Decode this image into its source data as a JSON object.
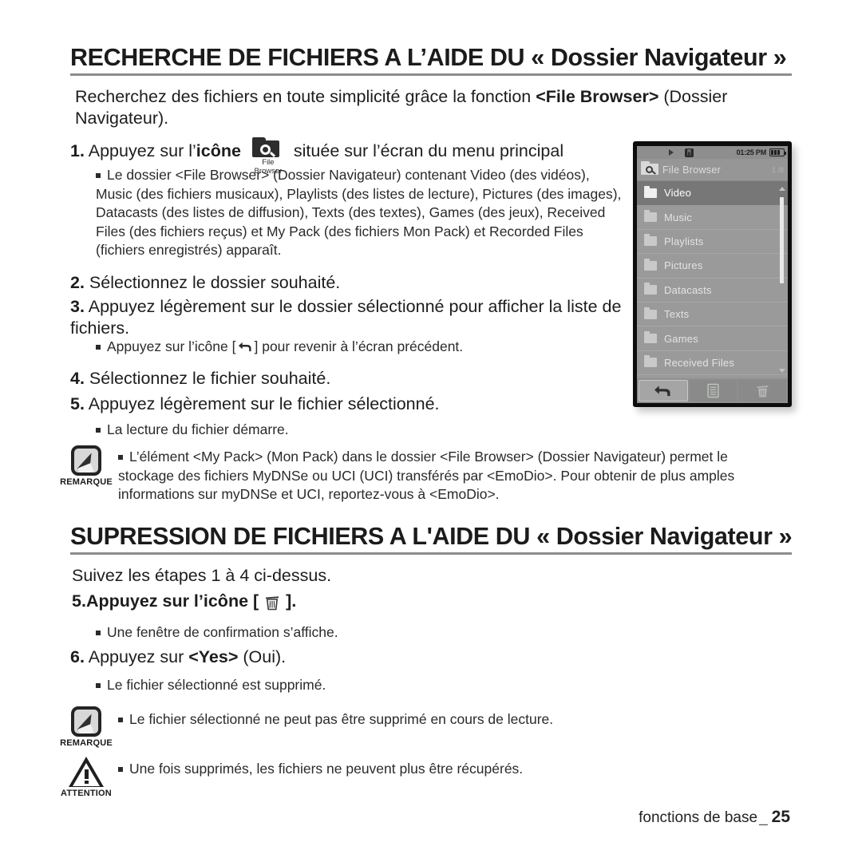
{
  "document": {
    "headings": {
      "search": "RECHERCHE DE FICHIERS A L’AIDE DU « Dossier Navigateur »",
      "delete": "SUPRESSION DE FICHIERS A L'AIDE DU « Dossier Navigateur »"
    },
    "intro": {
      "part1": "Recherchez des fichiers en toute simplicité grâce la fonction ",
      "bold": "<File Browser>",
      "part2": " (Dossier Navigateur)."
    },
    "steps": {
      "s1_num": "1.",
      "s1_before": "Appuyez sur l’",
      "s1_bold": "icône",
      "s1_after": "située sur l’écran du menu principal",
      "s1_icon_label": "File Browser",
      "s1_bullet": "Le dossier <File Browser> (Dossier Navigateur) contenant Video (des vidéos), Music (des fichiers musicaux), Playlists (des listes de lecture), Pictures (des images), Datacasts (des listes de diffusion), Texts (des textes), Games (des jeux), Received Files (des fichiers reçus) et My Pack (des fichiers Mon Pack) et Recorded Files (fichiers enregistrés) apparaît.",
      "s2_num": "2.",
      "s2_text": "Sélectionnez le dossier souhaité.",
      "s3_num": "3.",
      "s3_text": "Appuyez légèrement sur le dossier sélectionné pour afficher la liste de fichiers.",
      "s3_bullet_before": "Appuyez sur l’icône [",
      "s3_bullet_after": "] pour revenir à l’écran précédent.",
      "s4_num": "4.",
      "s4_text": "Sélectionnez le fichier souhaité.",
      "s5_num": "5.",
      "s5_text": "Appuyez légèrement sur le fichier sélectionné.",
      "s5_bullet": "La lecture du fichier démarre."
    },
    "note_1": {
      "label": "REMARQUE",
      "text": "L’élément <My Pack> (Mon Pack) dans le dossier <File Browser> (Dossier Navigateur) permet le stockage des fichiers MyDNSe ou UCI (UCI) transférés par <EmoDio>. Pour obtenir de plus amples informations sur myDNSe et UCI, reportez-vous à <EmoDio>."
    },
    "delete_section": {
      "lead": "Suivez les étapes 1 à 4 ci-dessus.",
      "d5_num": "5.",
      "d5_before": "Appuyez sur l’icône [",
      "d5_after": "].",
      "d5_bullet": "Une fenêtre de confirmation s’affiche.",
      "d6_num": "6.",
      "d6_before": "Appuyez sur ",
      "d6_bold": "<Yes>",
      "d6_after": " (Oui).",
      "d6_bullet": "Le fichier sélectionné est supprimé."
    },
    "note_2": {
      "label": "REMARQUE",
      "text": "Le fichier sélectionné ne peut pas être supprimé en cours de lecture."
    },
    "note_3": {
      "label": "ATTENTION",
      "text": "Une fois supprimés, les fichiers ne peuvent plus être récupérés."
    },
    "footer": {
      "text": "fonctions de base",
      "dash": "_",
      "page": "25"
    }
  },
  "device": {
    "statusbar": {
      "time": "01:25 PM",
      "bluetooth_glyph": "ᛗ"
    },
    "titlebar": {
      "title": "File Browser",
      "count": "1 /8"
    },
    "list": [
      {
        "label": "Video",
        "selected": true
      },
      {
        "label": "Music",
        "selected": false
      },
      {
        "label": "Playlists",
        "selected": false
      },
      {
        "label": "Pictures",
        "selected": false
      },
      {
        "label": "Datacasts",
        "selected": false
      },
      {
        "label": "Texts",
        "selected": false
      },
      {
        "label": "Games",
        "selected": false
      },
      {
        "label": "Received Files",
        "selected": false
      }
    ],
    "toolbar": {
      "back": "back-arrow",
      "menu": "list-menu",
      "delete": "trash"
    }
  },
  "colors": {
    "page_background": "#ffffff",
    "text": "#1d1d1d",
    "rule": "#8d8d8d",
    "screen_background": "#9a9a9a",
    "selected_row": "#777777",
    "device_frame": "#0d0d0d"
  }
}
